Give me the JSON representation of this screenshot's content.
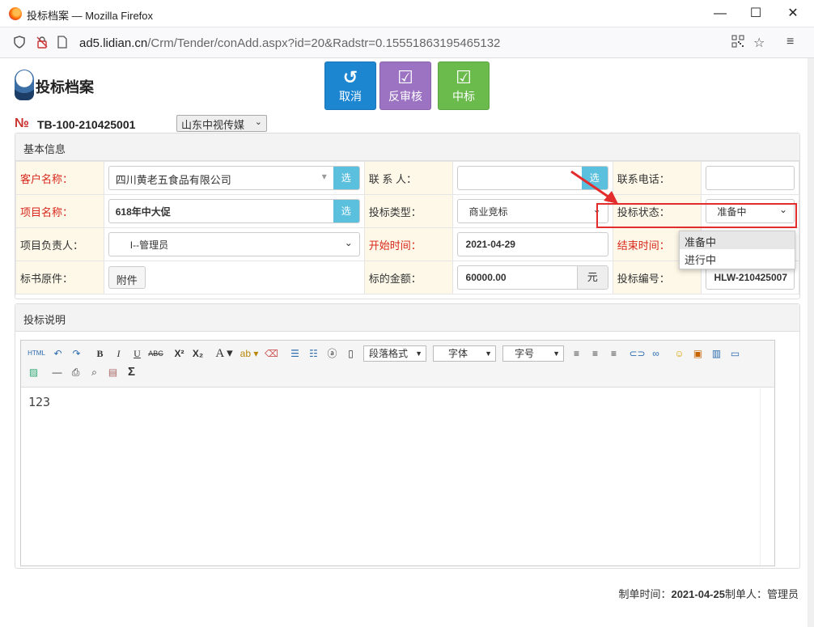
{
  "window": {
    "title": "投标档案 — Mozilla Firefox",
    "minimize": "—",
    "maximize": "☐",
    "close": "✕"
  },
  "urlbar": {
    "url_domain": "ad5.lidian.cn",
    "url_path": "/Crm/Tender/conAdd.aspx?id=20&Radstr=0.15551863195465132"
  },
  "header": {
    "title": "投标档案",
    "doc_symbol": "№",
    "doc_no": "TB-100-210425001",
    "company": "山东中视传媒"
  },
  "actions": {
    "cancel": "取消",
    "reaudit": "反审核",
    "win": "中标"
  },
  "basic": {
    "section_title": "基本信息",
    "customer_label": "客户名称：",
    "customer_value": "四川黄老五食品有限公司",
    "pick": "选",
    "contact_label": "联 系 人：",
    "contact_value": "",
    "phone_label": "联系电话：",
    "phone_value": "",
    "project_label": "项目名称：",
    "project_value": "618年中大促",
    "type_label": "投标类型：",
    "type_value": "商业竞标",
    "status_label": "投标状态：",
    "status_value": "准备中",
    "owner_label": "项目负责人：",
    "owner_value": "I--管理员",
    "start_label": "开始时间：",
    "start_value": "2021-04-29",
    "end_label": "结束时间：",
    "end_value": "",
    "doc_label": "标书原件：",
    "attach_button": "附件",
    "amount_label": "标的金额：",
    "amount_value": "60000.00",
    "amount_unit": "元",
    "bid_no_label": "投标编号：",
    "bid_no_value": "HLW-210425007"
  },
  "status_dropdown": {
    "options": [
      "准备中",
      "进行中"
    ]
  },
  "description": {
    "section_title": "投标说明",
    "toolbar": {
      "html": "HTML",
      "paragraph": "段落格式",
      "font": "字体",
      "size": "字号"
    },
    "content": "123"
  },
  "footer": {
    "created_label": "制单时间：",
    "created_value": "2021-04-25",
    "creator_label": "制单人：",
    "creator_value": "管理员"
  },
  "colors": {
    "cancel": "#1d86d1",
    "reaudit": "#9b73c2",
    "win": "#6abb4c",
    "required_label": "#d8271c",
    "highlight_box": "#e32c2c"
  }
}
